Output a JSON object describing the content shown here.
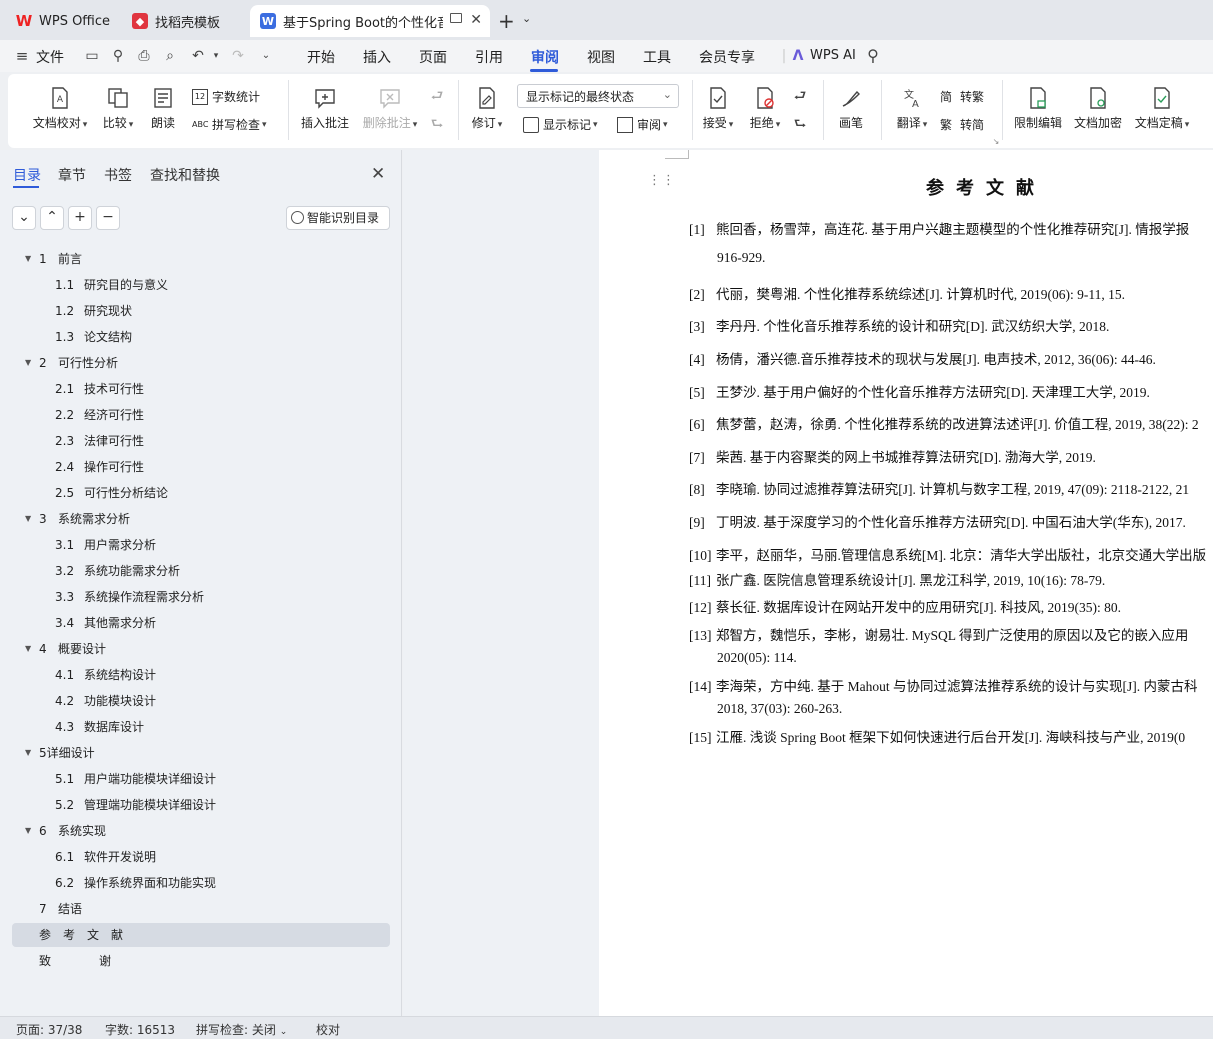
{
  "tabs": [
    {
      "label": "WPS Office"
    },
    {
      "label": "找稻壳模板"
    },
    {
      "label": "基于Spring Boot的个性化音乐推荐"
    }
  ],
  "menu": {
    "file": "文件",
    "items": [
      "开始",
      "插入",
      "页面",
      "引用",
      "审阅",
      "视图",
      "工具",
      "会员专享"
    ],
    "wps_ai": "WPS AI"
  },
  "ribbon": {
    "doc_proofread": "文档校对",
    "compare": "比较",
    "read_aloud": "朗读",
    "word_count": "字数统计",
    "spell_check": "拼写检查",
    "insert_comment": "插入批注",
    "delete_comment": "删除批注",
    "track_changes": "修订",
    "markup_state": "显示标记的最终状态",
    "show_markup": "显示标记",
    "review": "审阅",
    "accept": "接受",
    "reject": "拒绝",
    "ink": "画笔",
    "translate": "翻译",
    "to_traditional": "转繁",
    "to_simplified": "转简",
    "restrict_edit": "限制编辑",
    "encrypt": "文档加密",
    "finalize": "文档定稿"
  },
  "nav": {
    "tabs": [
      "目录",
      "章节",
      "书签",
      "查找和替换"
    ],
    "smart_toc": "智能识别目录",
    "toc": [
      {
        "num": "1",
        "text": "前言",
        "level": 1,
        "arrow": true
      },
      {
        "num": "1.1",
        "text": "研究目的与意义",
        "level": 2
      },
      {
        "num": "1.2",
        "text": "研究现状",
        "level": 2
      },
      {
        "num": "1.3",
        "text": "论文结构",
        "level": 2
      },
      {
        "num": "2",
        "text": "可行性分析",
        "level": 1,
        "arrow": true
      },
      {
        "num": "2.1",
        "text": "技术可行性",
        "level": 2
      },
      {
        "num": "2.2",
        "text": "经济可行性",
        "level": 2
      },
      {
        "num": "2.3",
        "text": "法律可行性",
        "level": 2
      },
      {
        "num": "2.4",
        "text": "操作可行性",
        "level": 2
      },
      {
        "num": "2.5",
        "text": "可行性分析结论",
        "level": 2
      },
      {
        "num": "3",
        "text": "系统需求分析",
        "level": 1,
        "arrow": true
      },
      {
        "num": "3.1",
        "text": "用户需求分析",
        "level": 2
      },
      {
        "num": "3.2",
        "text": "系统功能需求分析",
        "level": 2
      },
      {
        "num": "3.3",
        "text": "系统操作流程需求分析",
        "level": 2
      },
      {
        "num": "3.4",
        "text": "其他需求分析",
        "level": 2
      },
      {
        "num": "4",
        "text": "概要设计",
        "level": 1,
        "arrow": true
      },
      {
        "num": "4.1",
        "text": "系统结构设计",
        "level": 2
      },
      {
        "num": "4.2",
        "text": "功能模块设计",
        "level": 2
      },
      {
        "num": "4.3",
        "text": "数据库设计",
        "level": 2
      },
      {
        "num": "",
        "text": "5详细设计",
        "level": 1,
        "arrow": true
      },
      {
        "num": "5.1",
        "text": "用户端功能模块详细设计",
        "level": 2
      },
      {
        "num": "5.2",
        "text": "管理端功能模块详细设计",
        "level": 2
      },
      {
        "num": "6",
        "text": "系统实现",
        "level": 1,
        "arrow": true
      },
      {
        "num": "6.1",
        "text": "软件开发说明",
        "level": 2
      },
      {
        "num": "6.2",
        "text": "操作系统界面和功能实现",
        "level": 2
      },
      {
        "num": "7",
        "text": "结语",
        "level": 1
      },
      {
        "num": "",
        "text": "参　考　文　献",
        "level": 0,
        "selected": true
      },
      {
        "num": "",
        "text": "致　　　　谢",
        "level": 0
      }
    ]
  },
  "document": {
    "title": "参考文献",
    "refs": [
      {
        "n": "[1]",
        "text": "熊回香，杨雪萍，高连花. 基于用户兴趣主题模型的个性化推荐研究[J]. 情报学报",
        "cont": "916-929."
      },
      {
        "n": "[2]",
        "text": "代丽，樊粤湘. 个性化推荐系统综述[J]. 计算机时代, 2019(06): 9-11, 15."
      },
      {
        "n": "[3]",
        "text": "李丹丹. 个性化音乐推荐系统的设计和研究[D]. 武汉纺织大学, 2018."
      },
      {
        "n": "[4]",
        "text": "杨倩，潘兴德.音乐推荐技术的现状与发展[J]. 电声技术, 2012, 36(06): 44-46."
      },
      {
        "n": "[5]",
        "text": "王梦沙. 基于用户偏好的个性化音乐推荐方法研究[D]. 天津理工大学, 2019."
      },
      {
        "n": "[6]",
        "text": "焦梦蕾，赵涛，徐勇. 个性化推荐系统的改进算法述评[J]. 价值工程, 2019, 38(22): 2"
      },
      {
        "n": "[7]",
        "text": "柴茜. 基于内容聚类的网上书城推荐算法研究[D]. 渤海大学, 2019."
      },
      {
        "n": "[8]",
        "text": "李晓瑜. 协同过滤推荐算法研究[J]. 计算机与数字工程, 2019, 47(09): 2118-2122, 21"
      },
      {
        "n": "[9]",
        "text": "丁明波. 基于深度学习的个性化音乐推荐方法研究[D]. 中国石油大学(华东), 2017."
      },
      {
        "n": "[10]",
        "text": "李平，赵丽华，马丽.管理信息系统[M]. 北京：清华大学出版社，北京交通大学出版"
      },
      {
        "n": "[11]",
        "text": "张广鑫. 医院信息管理系统设计[J]. 黑龙江科学, 2019, 10(16): 78-79."
      },
      {
        "n": "[12]",
        "text": "蔡长征. 数据库设计在网站开发中的应用研究[J]. 科技风, 2019(35): 80."
      },
      {
        "n": "[13]",
        "text": "郑智方，魏恺乐，李彬，谢易壮. MySQL 得到广泛使用的原因以及它的嵌入应用",
        "cont": "2020(05): 114."
      },
      {
        "n": "[14]",
        "text": "李海荣，方中纯. 基于 Mahout 与协同过滤算法推荐系统的设计与实现[J]. 内蒙古科",
        "cont": "2018, 37(03): 260-263."
      },
      {
        "n": "[15]",
        "text": "江雁. 浅谈 Spring Boot 框架下如何快速进行后台开发[J]. 海峡科技与产业, 2019(0"
      }
    ]
  },
  "status": {
    "page": "页面: 37/38",
    "words": "字数: 16513",
    "spell": "拼写检查: 关闭",
    "proof": "校对"
  }
}
